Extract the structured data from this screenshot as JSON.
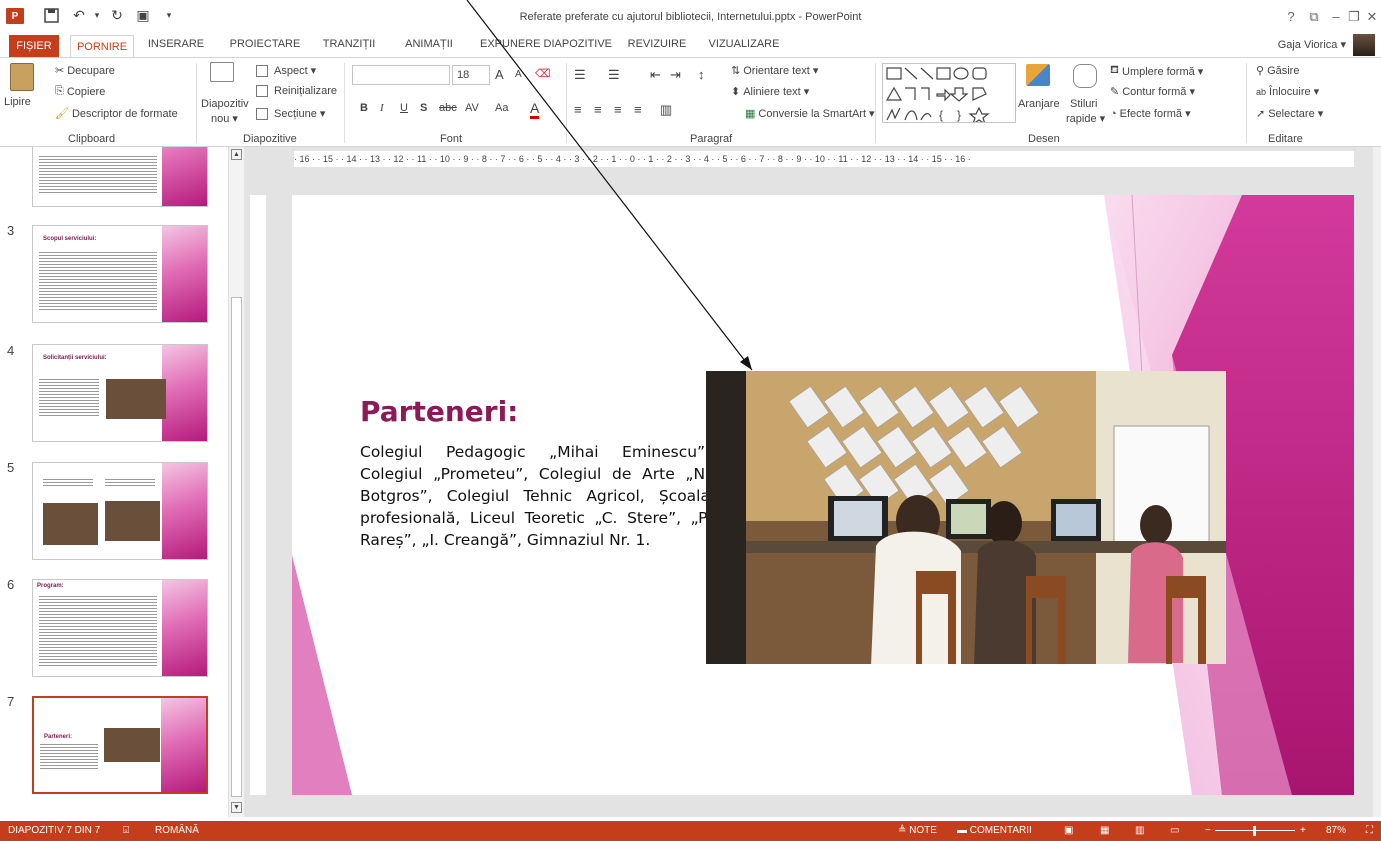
{
  "window": {
    "title": "Referate preferate cu ajutorul bibliotecii, Internetului.pptx - PowerPoint",
    "help": "?",
    "restore": "⧉",
    "minimize": "–",
    "maximize": "❐",
    "close": "✕"
  },
  "qat": {
    "logo": "P",
    "save": "💾",
    "undo": "↶",
    "redo": "↻",
    "present": "▣",
    "more": "▾"
  },
  "tabs": [
    "FIȘIER",
    "PORNIRE",
    "INSERARE",
    "PROIECTARE",
    "TRANZIȚII",
    "ANIMAȚII",
    "EXPUNERE DIAPOZITIVE",
    "REVIZUIRE",
    "VIZUALIZARE"
  ],
  "user": {
    "name": "Gaja Viorica",
    "dropdown": "▾"
  },
  "ribbon": {
    "clipboard": {
      "paste": "Lipire",
      "cut": "Decupare",
      "copy": "Copiere",
      "format_painter": "Descriptor de formate",
      "label": "Clipboard"
    },
    "slides": {
      "new_slide_1": "Diapozitiv",
      "new_slide_2": "nou ▾",
      "layout": "Aspect ▾",
      "reset": "Reinițializare",
      "section": "Secțiune ▾",
      "label": "Diapozitive"
    },
    "font": {
      "font_name": "",
      "font_size": "18",
      "bold": "B",
      "italic": "I",
      "underline": "U",
      "shadow": "S",
      "strike": "abc",
      "spacing": "AV",
      "case": "Aa",
      "color": "A",
      "grow": "A",
      "shrink": "A",
      "label": "Font"
    },
    "paragraph": {
      "text_direction": "Orientare text ▾",
      "align_text": "Aliniere text ▾",
      "smartart": "Conversie la SmartArt ▾",
      "label": "Paragraf"
    },
    "drawing": {
      "arrange": "Aranjare",
      "quick_styles_1": "Stiluri",
      "quick_styles_2": "rapide ▾",
      "fill": "Umplere formă ▾",
      "outline": "Contur formă ▾",
      "effects": "Efecte formă ▾",
      "label": "Desen"
    },
    "editing": {
      "find": "Găsire",
      "replace": "Înlocuire ▾",
      "select": "Selectare ▾",
      "label": "Editare"
    }
  },
  "thumbnails": [
    {
      "num": "",
      "title": ""
    },
    {
      "num": "3",
      "title": "Scopul serviciului:"
    },
    {
      "num": "4",
      "title": "Solicitanții serviciului:"
    },
    {
      "num": "5",
      "title": ""
    },
    {
      "num": "6",
      "title": "Program:"
    },
    {
      "num": "7",
      "title": "Parteneri:"
    }
  ],
  "slide": {
    "heading": "Parteneri:",
    "body": "Colegiul Pedagogic „Mihai Eminescu”, Colegiul „Prometeu”, Colegiul de Arte „N. Botgros”, Colegiul Tehnic Agricol, Școala profesională, Liceul Teoretic „C. Stere”, „P. Rareș”, „I. Creangă”, Gimnaziul Nr. 1.",
    "photo_desc": ""
  },
  "ruler_text": "· 16 · · 15 · · 14 · · 13 · · 12 · · 11 · · 10 · · 9 · · 8 · · 7 · · 6 · · 5 · · 4 · · 3 · · 2 · · 1 · · 0 · · 1 · · 2 · · 3 · · 4 · · 5 · · 6 · · 7 · · 8 · · 9 · · 10 · · 11 · · 12 · · 13 · · 14 · · 15 · · 16 ·",
  "status": {
    "slide_of": "DIAPOZITIV 7 DIN 7",
    "language": "ROMÂNĂ",
    "notes": "≜ NOTE",
    "comments": "COMENTARII",
    "zoom": "87%"
  },
  "colors": {
    "accent": "#c43e1c",
    "title": "#8c1a57",
    "pink": "#d33a9b"
  }
}
